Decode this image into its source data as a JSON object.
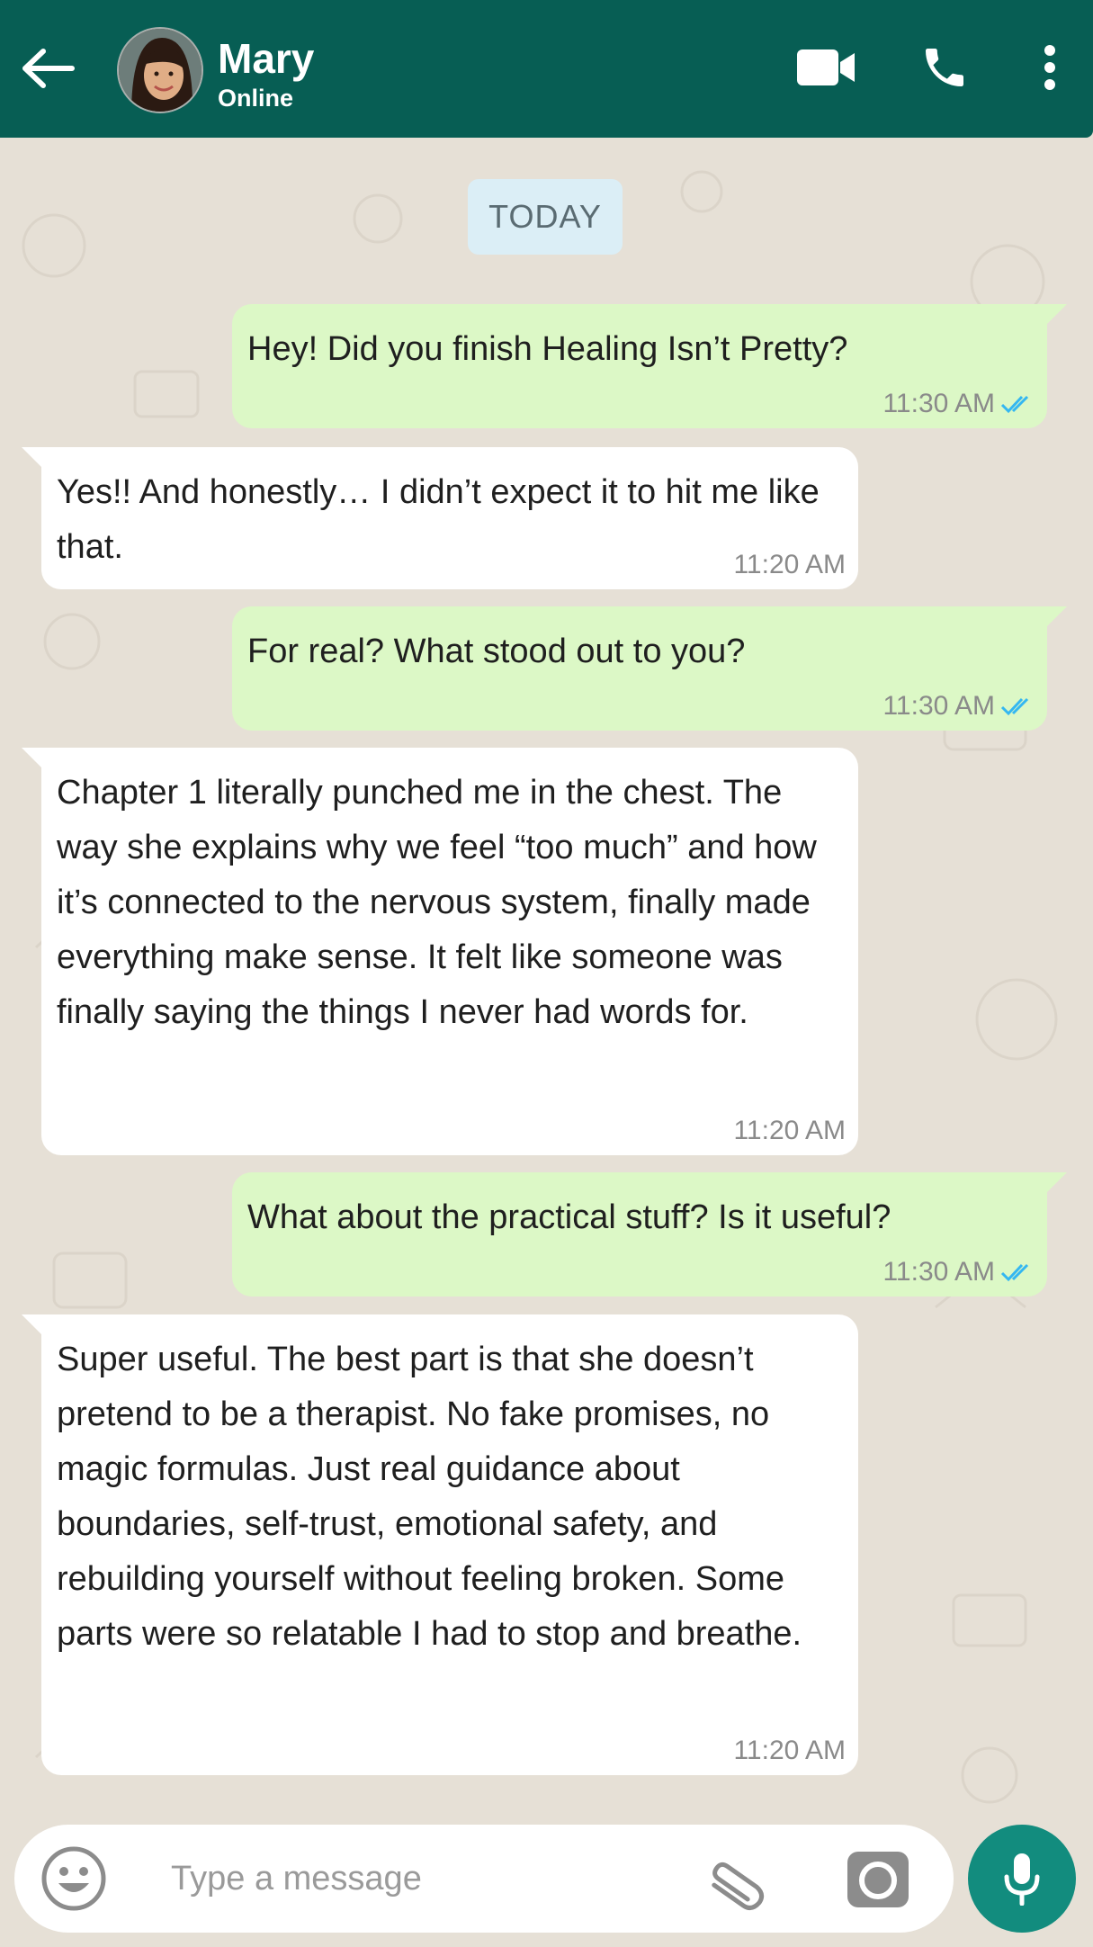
{
  "header": {
    "contact_name": "Mary",
    "status": "Online",
    "back_icon": "arrow-left-icon",
    "video_icon": "video-camera-icon",
    "call_icon": "phone-icon",
    "menu_icon": "more-vert-icon"
  },
  "chat": {
    "date_label": "TODAY",
    "messages": [
      {
        "direction": "out",
        "text": "Hey! Did you finish Healing Isn’t Pretty?",
        "time": "11:30 AM",
        "status": "read"
      },
      {
        "direction": "in",
        "text": "Yes!! And honestly… I didn’t expect it to hit me like that.",
        "time": "11:20 AM"
      },
      {
        "direction": "out",
        "text": "For real? What stood out to you?",
        "time": "11:30 AM",
        "status": "read"
      },
      {
        "direction": "in",
        "text": "Chapter 1 literally punched me in the chest. The way she explains why we feel “too much” and how it’s connected to the nervous system, finally made everything make sense. It felt like someone was finally saying the things I never had words for.",
        "time": "11:20 AM"
      },
      {
        "direction": "out",
        "text": "What about the practical stuff? Is it useful?",
        "time": "11:30 AM",
        "status": "read"
      },
      {
        "direction": "in",
        "text": "Super useful. The best part is that she doesn’t pretend to be a therapist. No fake promises, no magic formulas. Just real guidance about boundaries, self-trust, emotional safety, and rebuilding yourself without feeling broken. Some parts were so relatable I had to stop and breathe.",
        "time": "11:20 AM"
      }
    ]
  },
  "composer": {
    "placeholder": "Type a message",
    "emoji_icon": "emoji-icon",
    "attach_icon": "paperclip-icon",
    "camera_icon": "camera-icon",
    "mic_icon": "microphone-icon"
  },
  "colors": {
    "header": "#075e54",
    "outgoing_bubble": "#dcf8c6",
    "incoming_bubble": "#ffffff",
    "background": "#e6e0d6",
    "mic_button": "#128c7e",
    "read_ticks": "#34b7f1"
  }
}
